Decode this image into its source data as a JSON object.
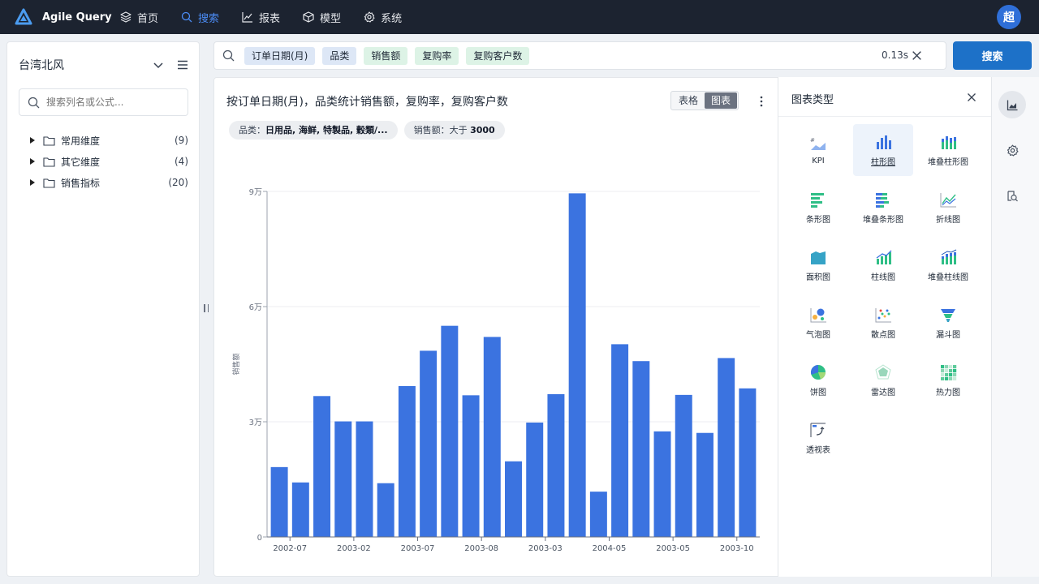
{
  "app": {
    "name": "Agile Query",
    "user_initial": "超"
  },
  "nav": [
    {
      "label": "首页",
      "icon": "layers-icon"
    },
    {
      "label": "搜索",
      "icon": "search-icon",
      "active": true
    },
    {
      "label": "报表",
      "icon": "report-chart-icon"
    },
    {
      "label": "模型",
      "icon": "cube-icon"
    },
    {
      "label": "系统",
      "icon": "gear-icon"
    }
  ],
  "sidebar": {
    "datasource": "台湾北风",
    "search_placeholder": "搜索列名或公式...",
    "tree": [
      {
        "label": "常用维度",
        "count": "(9)"
      },
      {
        "label": "其它维度",
        "count": "(4)"
      },
      {
        "label": "销售指标",
        "count": "(20)"
      }
    ]
  },
  "search": {
    "tokens": [
      {
        "text": "订单日期(月)",
        "kind": "dimension"
      },
      {
        "text": "品类",
        "kind": "dimension"
      },
      {
        "text": "销售额",
        "kind": "metric"
      },
      {
        "text": "复购率",
        "kind": "metric"
      },
      {
        "text": "复购客户数",
        "kind": "metric"
      }
    ],
    "elapsed": "0.13s",
    "button_label": "搜索"
  },
  "result": {
    "title": "按订单日期(月)，品类统计销售额，复购率，复购客户数",
    "views": {
      "table": "表格",
      "chart": "图表",
      "active": "chart"
    },
    "filters": [
      {
        "key": "品类：",
        "value": "日用品, 海鲜, 特製品, 穀類/..."
      },
      {
        "key": "销售额：",
        "value_prefix": "大于 ",
        "value": "3000"
      }
    ]
  },
  "chart_data": {
    "type": "bar",
    "ylabel": "销售额",
    "ylim": [
      0,
      90000
    ],
    "yticks": [
      {
        "value": 0,
        "label": "0"
      },
      {
        "value": 30000,
        "label": "3万"
      },
      {
        "value": 60000,
        "label": "6万"
      },
      {
        "value": 90000,
        "label": "9万"
      }
    ],
    "xtick_labels": [
      {
        "index": 1,
        "label": "2002-07"
      },
      {
        "index": 4,
        "label": "2003-02"
      },
      {
        "index": 7,
        "label": "2003-07"
      },
      {
        "index": 10,
        "label": "2003-08"
      },
      {
        "index": 13,
        "label": "2003-03"
      },
      {
        "index": 16,
        "label": "2004-05"
      },
      {
        "index": 19,
        "label": "2003-05"
      },
      {
        "index": 22,
        "label": "2003-10"
      }
    ],
    "values": [
      18200,
      14200,
      36700,
      30100,
      30100,
      14000,
      39300,
      48500,
      55000,
      36900,
      52100,
      19700,
      29800,
      37200,
      89500,
      11800,
      50200,
      45800,
      27500,
      37000,
      27100,
      46600,
      38700
    ],
    "bar_color": "#3b73e0",
    "grid": true,
    "legend": "none"
  },
  "chart_types": {
    "title": "图表类型",
    "selected": "柱形图",
    "items": [
      {
        "label": "KPI",
        "icon": "kpi-icon"
      },
      {
        "label": "柱形图",
        "icon": "column-chart-icon"
      },
      {
        "label": "堆叠柱形图",
        "icon": "stacked-column-chart-icon"
      },
      {
        "label": "条形图",
        "icon": "bar-chart-icon"
      },
      {
        "label": "堆叠条形图",
        "icon": "stacked-bar-chart-icon"
      },
      {
        "label": "折线图",
        "icon": "line-chart-icon"
      },
      {
        "label": "面积图",
        "icon": "area-chart-icon"
      },
      {
        "label": "柱线图",
        "icon": "column-line-chart-icon"
      },
      {
        "label": "堆叠柱线图",
        "icon": "stacked-column-line-chart-icon"
      },
      {
        "label": "气泡图",
        "icon": "bubble-chart-icon"
      },
      {
        "label": "散点图",
        "icon": "scatter-chart-icon"
      },
      {
        "label": "漏斗图",
        "icon": "funnel-chart-icon"
      },
      {
        "label": "饼图",
        "icon": "pie-chart-icon"
      },
      {
        "label": "雷达图",
        "icon": "radar-chart-icon"
      },
      {
        "label": "热力图",
        "icon": "heatmap-icon"
      },
      {
        "label": "透视表",
        "icon": "pivot-table-icon"
      }
    ]
  },
  "colors": {
    "accent": "#1d71c8",
    "topbar": "#1c2330",
    "bar": "#3b73e0"
  }
}
